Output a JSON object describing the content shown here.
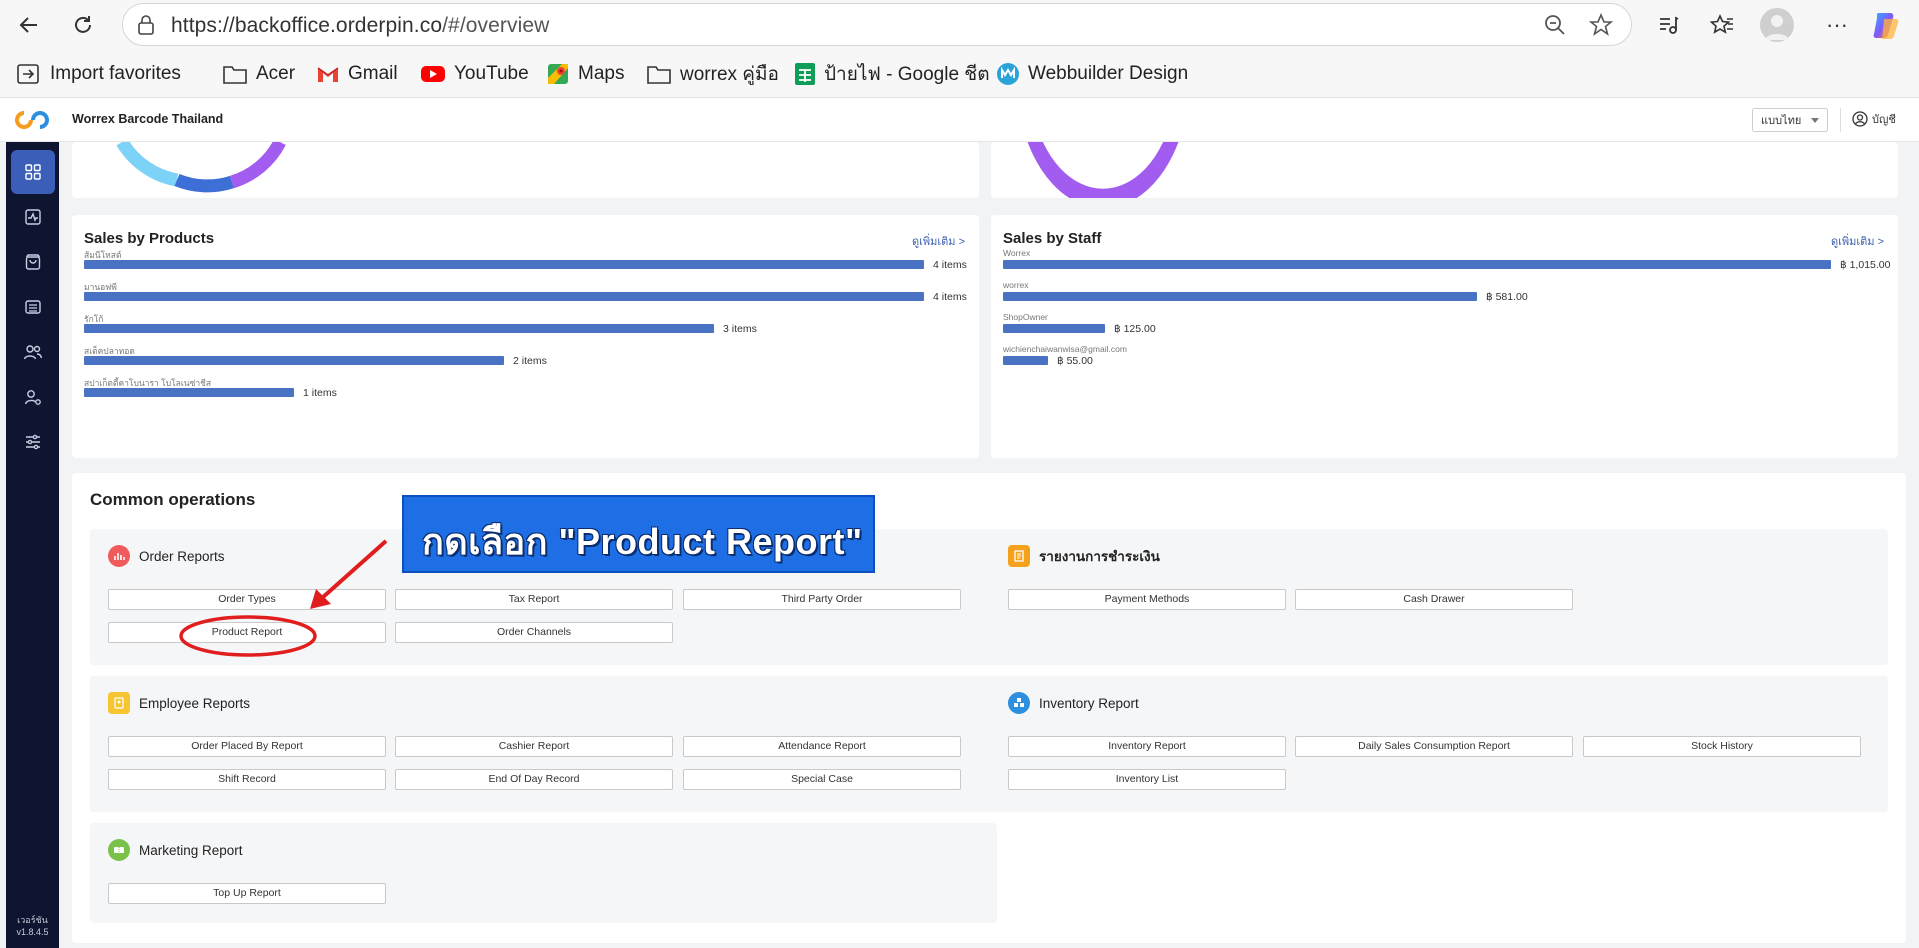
{
  "browser": {
    "url_host": "https://backoffice.orderpin.co",
    "url_path": "/#/overview",
    "bookmarks": [
      {
        "label": "Import favorites",
        "icon": "import-icon"
      },
      {
        "label": "Acer",
        "icon": "folder-icon"
      },
      {
        "label": "Gmail",
        "icon": "gmail-icon"
      },
      {
        "label": "YouTube",
        "icon": "youtube-icon"
      },
      {
        "label": "Maps",
        "icon": "maps-icon"
      },
      {
        "label": "worrex คู่มือ",
        "icon": "folder-icon"
      },
      {
        "label": "ป้ายไฟ - Google ชีต",
        "icon": "sheets-icon"
      },
      {
        "label": "Webbuilder Design",
        "icon": "webbuilder-icon"
      }
    ]
  },
  "header": {
    "shop_name": "Worrex Barcode Thailand",
    "language": "แบบไทย",
    "account": "บัญชี"
  },
  "sidebar": {
    "items": [
      {
        "icon": "dashboard-icon",
        "active": true
      },
      {
        "icon": "activity-icon",
        "active": false
      },
      {
        "icon": "bag-icon",
        "active": false
      },
      {
        "icon": "list-icon",
        "active": false
      },
      {
        "icon": "users-icon",
        "active": false
      },
      {
        "icon": "user-settings-icon",
        "active": false
      },
      {
        "icon": "sliders-icon",
        "active": false
      }
    ],
    "version_label": "เวอร์ชัน",
    "version": "v1.8.4.5"
  },
  "sales_by_products": {
    "title": "Sales by Products",
    "more": "ดูเพิ่มเติม >",
    "rows": [
      {
        "label": "ส้มนีโหสต์",
        "value": "4 items",
        "amount": 4
      },
      {
        "label": "มานอฟพี",
        "value": "4 items",
        "amount": 4
      },
      {
        "label": "รักโก้",
        "value": "3 items",
        "amount": 3
      },
      {
        "label": "สเต็คปลาทอด",
        "value": "2 items",
        "amount": 2
      },
      {
        "label": "สปาเก็ตตี้คาโบนารา โบโลเนซ่าชีส",
        "value": "1 items",
        "amount": 1
      }
    ]
  },
  "sales_by_staff": {
    "title": "Sales by Staff",
    "more": "ดูเพิ่มเติม >",
    "rows": [
      {
        "label": "Worrex",
        "value": "฿ 1,015.00",
        "amount": 1015
      },
      {
        "label": "worrex",
        "value": "฿ 581.00",
        "amount": 581
      },
      {
        "label": "ShopOwner",
        "value": "฿ 125.00",
        "amount": 125
      },
      {
        "label": "wichienchaiwanwisa@gmail.com",
        "value": "฿ 55.00",
        "amount": 55
      }
    ]
  },
  "common_operations": {
    "title": "Common operations",
    "groups": {
      "order_reports": {
        "title": "Order Reports",
        "buttons": [
          "Order Types",
          "Tax Report",
          "Third Party Order",
          "Product Report",
          "Order Channels"
        ]
      },
      "payment_reports": {
        "title": "รายงานการชำระเงิน",
        "buttons": [
          "Payment Methods",
          "Cash Drawer"
        ]
      },
      "employee_reports": {
        "title": "Employee Reports",
        "buttons": [
          "Order Placed By Report",
          "Cashier Report",
          "Attendance Report",
          "Shift Record",
          "End Of Day Record",
          "Special Case"
        ]
      },
      "inventory_report": {
        "title": "Inventory Report",
        "buttons": [
          "Inventory Report",
          "Daily Sales Consumption Report",
          "Stock History",
          "Inventory List"
        ]
      },
      "marketing_report": {
        "title": "Marketing Report",
        "buttons": [
          "Top Up Report"
        ]
      }
    }
  },
  "annotation": {
    "callout_text": "กดเลือก \"Product Report\"",
    "highlight_color": "#e01e1e",
    "callout_color": "#1e6ee6"
  },
  "colors": {
    "bar": "#4a72c4",
    "sidebar": "#0e1530",
    "sidebar_active": "#3b5fb8",
    "order_icon": "#f05a5a",
    "payment_icon": "#f4a21b",
    "employee_icon": "#f7c531",
    "inventory_icon": "#2d8fe0",
    "marketing_icon": "#7ac14a"
  }
}
